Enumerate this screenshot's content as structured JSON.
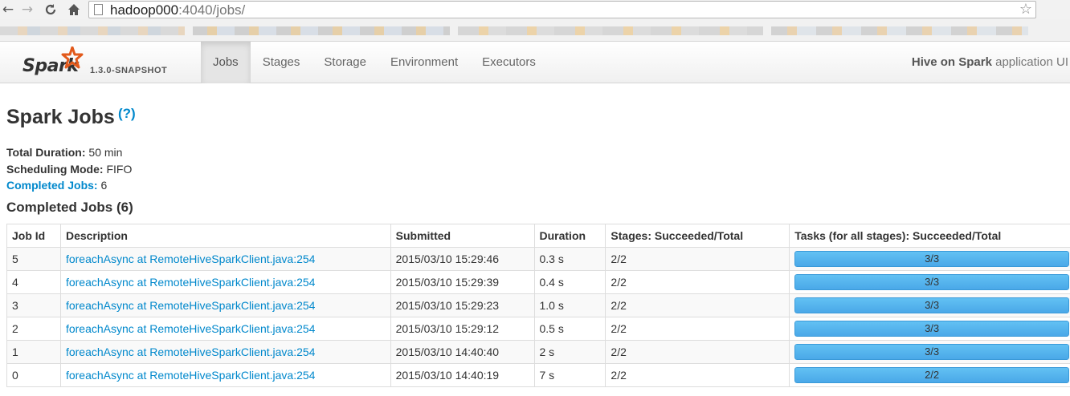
{
  "browser": {
    "url_host": "hadoop000",
    "url_path": ":4040/jobs/",
    "back_icon": "arrow-left-icon",
    "forward_icon": "arrow-right-icon",
    "reload_icon": "reload-icon",
    "home_icon": "home-icon",
    "star_icon": "star-icon"
  },
  "navbar": {
    "brand": "Spark",
    "version": "1.3.0-SNAPSHOT",
    "tabs": [
      {
        "label": "Jobs",
        "active": true
      },
      {
        "label": "Stages",
        "active": false
      },
      {
        "label": "Storage",
        "active": false
      },
      {
        "label": "Environment",
        "active": false
      },
      {
        "label": "Executors",
        "active": false
      }
    ],
    "app_name_bold": "Hive on Spark",
    "app_name_suffix": " application UI"
  },
  "page": {
    "title": "Spark Jobs",
    "help": "(?)",
    "summary": {
      "total_duration_label": "Total Duration:",
      "total_duration_value": " 50 min",
      "scheduling_mode_label": "Scheduling Mode:",
      "scheduling_mode_value": " FIFO",
      "completed_jobs_label": "Completed Jobs:",
      "completed_jobs_value": " 6"
    },
    "section_title": "Completed Jobs (6)"
  },
  "table": {
    "headers": [
      "Job Id",
      "Description",
      "Submitted",
      "Duration",
      "Stages: Succeeded/Total",
      "Tasks (for all stages): Succeeded/Total"
    ],
    "rows": [
      {
        "id": "5",
        "description": "foreachAsync at RemoteHiveSparkClient.java:254",
        "submitted": "2015/03/10 15:29:46",
        "duration": "0.3 s",
        "stages": "2/2",
        "tasks": "3/3",
        "tasks_fraction": 1.0
      },
      {
        "id": "4",
        "description": "foreachAsync at RemoteHiveSparkClient.java:254",
        "submitted": "2015/03/10 15:29:39",
        "duration": "0.4 s",
        "stages": "2/2",
        "tasks": "3/3",
        "tasks_fraction": 1.0
      },
      {
        "id": "3",
        "description": "foreachAsync at RemoteHiveSparkClient.java:254",
        "submitted": "2015/03/10 15:29:23",
        "duration": "1.0 s",
        "stages": "2/2",
        "tasks": "3/3",
        "tasks_fraction": 1.0
      },
      {
        "id": "2",
        "description": "foreachAsync at RemoteHiveSparkClient.java:254",
        "submitted": "2015/03/10 15:29:12",
        "duration": "0.5 s",
        "stages": "2/2",
        "tasks": "3/3",
        "tasks_fraction": 1.0
      },
      {
        "id": "1",
        "description": "foreachAsync at RemoteHiveSparkClient.java:254",
        "submitted": "2015/03/10 14:40:40",
        "duration": "2 s",
        "stages": "2/2",
        "tasks": "3/3",
        "tasks_fraction": 1.0
      },
      {
        "id": "0",
        "description": "foreachAsync at RemoteHiveSparkClient.java:254",
        "submitted": "2015/03/10 14:40:19",
        "duration": "7 s",
        "stages": "2/2",
        "tasks": "2/2",
        "tasks_fraction": 1.0
      }
    ]
  },
  "colors": {
    "link": "#0088cc",
    "progress_fill": "#4aa8e8",
    "brand_star": "#e25a1c"
  }
}
